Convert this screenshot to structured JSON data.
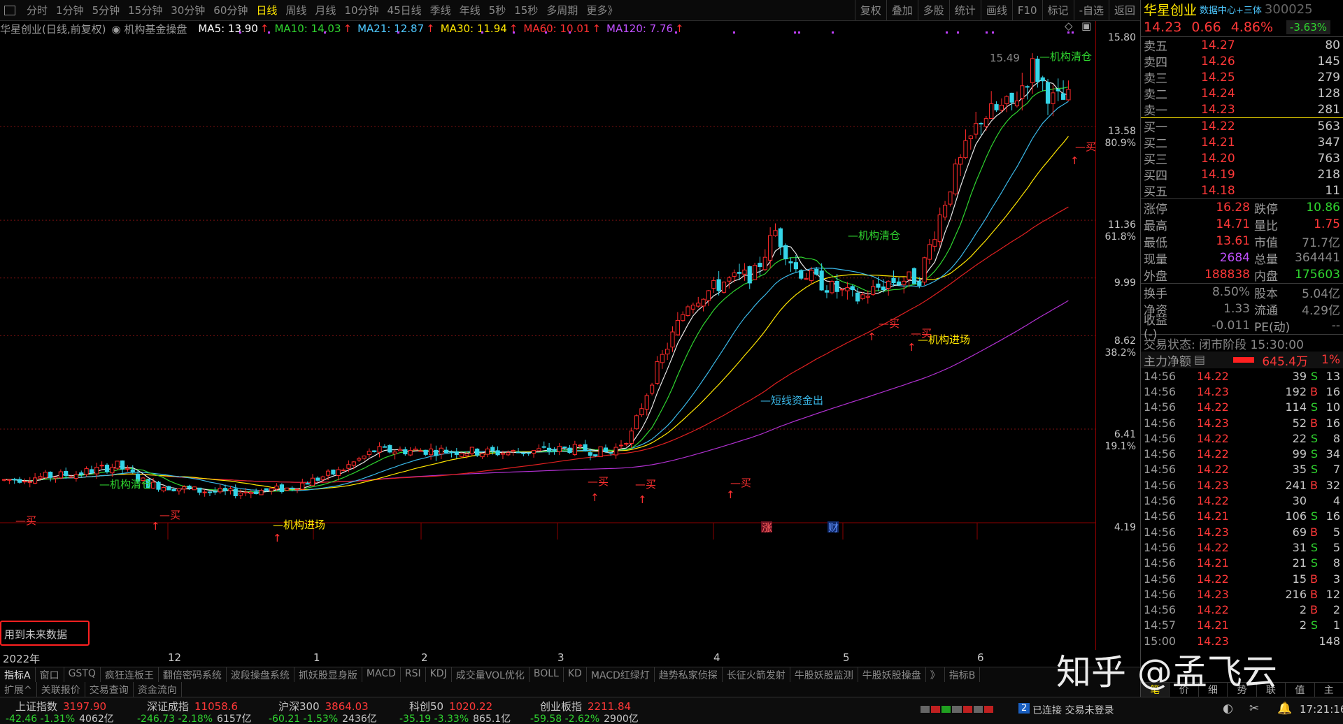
{
  "toolbar": {
    "periods": [
      "分时",
      "1分钟",
      "5分钟",
      "15分钟",
      "30分钟",
      "60分钟",
      "日线",
      "周线",
      "月线",
      "10分钟",
      "45日线",
      "季线",
      "年线",
      "5秒",
      "15秒",
      "多周期",
      "更多》"
    ],
    "active_period": "日线",
    "tools": [
      "复权",
      "叠加",
      "多股",
      "统计",
      "画线",
      "F10",
      "标记",
      "-自选",
      "返回"
    ]
  },
  "info": {
    "stock_title": "华星创业(日线,前复权)",
    "indicator_name": "机构基金操盘",
    "ma": [
      {
        "label": "MA5: 13.90",
        "color": "#ffffff"
      },
      {
        "label": "MA10: 14.03",
        "color": "#2fd42f"
      },
      {
        "label": "MA21: 12.87",
        "color": "#4ec8ff"
      },
      {
        "label": "MA30: 11.94",
        "color": "#ffe600"
      },
      {
        "label": "MA60: 10.01",
        "color": "#ff3030"
      },
      {
        "label": "MA120: 7.76",
        "color": "#c050ff"
      }
    ],
    "up_arrow": "↑"
  },
  "price_axis": [
    {
      "label": "15.80"
    },
    {
      "label": "13.58",
      "pct": "80.9%"
    },
    {
      "label": "11.36",
      "pct": "61.8%"
    },
    {
      "label": "9.99"
    },
    {
      "label": "8.62",
      "pct": "38.2%"
    },
    {
      "label": "6.41",
      "pct": "19.1%"
    },
    {
      "label": "4.19"
    }
  ],
  "date_axis": [
    "2022年",
    "12",
    "1",
    "2",
    "3",
    "4",
    "5",
    "6"
  ],
  "annotations": {
    "clear_pos": "机构清仓",
    "enter": "机构进场",
    "buy": "买",
    "short_out": "短线资金出",
    "high_price": "15.49",
    "zhang": "涨",
    "cai": "财",
    "future_data": "用到未来数据"
  },
  "indicator_tabs": [
    "指标A",
    "窗口",
    "GSTQ",
    "疯狂连板王",
    "翻倍密码系统",
    "波段操盘系统",
    "抓妖股显身版",
    "MACD",
    "RSI",
    "KDJ",
    "成交量VOL优化",
    "BOLL",
    "KD",
    "MACD红绿灯",
    "趋势私家侦探",
    "长征火箭发射",
    "牛股妖股监测",
    "牛股妖股操盘",
    "》",
    "指标B"
  ],
  "ext_tabs": [
    "扩展^",
    "关联报价",
    "交易查询",
    "资金流向"
  ],
  "status": {
    "indices": [
      {
        "name": "上证指数",
        "value": "3197.90",
        "chg": "-42.46",
        "pct": "-1.31%",
        "vol": "4062亿"
      },
      {
        "name": "深证成指",
        "value": "11058.6",
        "chg": "-246.73",
        "pct": "-2.18%",
        "vol": "6157亿"
      },
      {
        "name": "沪深300",
        "value": "3864.03",
        "chg": "-60.21",
        "pct": "-1.53%",
        "vol": "2436亿"
      },
      {
        "name": "科创50",
        "value": "1020.22",
        "chg": "-35.19",
        "pct": "-3.33%",
        "vol": "865.1亿"
      },
      {
        "name": "创业板指",
        "value": "2211.84",
        "chg": "-59.58",
        "pct": "-2.62%",
        "vol": "2900亿"
      }
    ],
    "conn_num": "2",
    "connected": "已连接 交易未登录",
    "time": "17:21:16"
  },
  "right_panel": {
    "name": "华星创业",
    "tag": "数据中心+三体",
    "code": "300025",
    "price": "14.23",
    "change": "0.66",
    "change_pct": "4.86%",
    "badge": "-3.63%",
    "asks": [
      {
        "label": "卖五",
        "price": "14.27",
        "vol": "80"
      },
      {
        "label": "卖四",
        "price": "14.26",
        "vol": "145"
      },
      {
        "label": "卖三",
        "price": "14.25",
        "vol": "279"
      },
      {
        "label": "卖二",
        "price": "14.24",
        "vol": "128"
      },
      {
        "label": "卖一",
        "price": "14.23",
        "vol": "281"
      }
    ],
    "bids": [
      {
        "label": "买一",
        "price": "14.22",
        "vol": "563"
      },
      {
        "label": "买二",
        "price": "14.21",
        "vol": "347"
      },
      {
        "label": "买三",
        "price": "14.20",
        "vol": "763"
      },
      {
        "label": "买四",
        "price": "14.19",
        "vol": "218"
      },
      {
        "label": "买五",
        "price": "14.18",
        "vol": "11"
      }
    ],
    "stats1": [
      {
        "l1": "涨停",
        "v1": "16.28",
        "c1": "red",
        "l2": "跌停",
        "v2": "10.86",
        "c2": "green"
      },
      {
        "l1": "最高",
        "v1": "14.71",
        "c1": "red",
        "l2": "量比",
        "v2": "1.75",
        "c2": "red"
      },
      {
        "l1": "最低",
        "v1": "13.61",
        "c1": "red",
        "l2": "市值",
        "v2": "71.7亿",
        "c2": "gray"
      },
      {
        "l1": "现量",
        "v1": "2684",
        "c1": "purple",
        "l2": "总量",
        "v2": "364441",
        "c2": "gray"
      },
      {
        "l1": "外盘",
        "v1": "188838",
        "c1": "red",
        "l2": "内盘",
        "v2": "175603",
        "c2": "green"
      }
    ],
    "stats2": [
      {
        "l1": "换手",
        "v1": "8.50%",
        "c1": "gray",
        "l2": "股本",
        "v2": "5.04亿",
        "c2": "gray"
      },
      {
        "l1": "净资",
        "v1": "1.33",
        "c1": "gray",
        "l2": "流通",
        "v2": "4.29亿",
        "c2": "gray"
      },
      {
        "l1": "收益(-)",
        "v1": "-0.011",
        "c1": "gray",
        "l2": "PE(动)",
        "v2": "--",
        "c2": "gray"
      }
    ],
    "state": "交易状态: 闭市阶段 15:30:00",
    "flow_label": "主力净额",
    "flow_value": "645.4万",
    "flow_pct": "1%",
    "ticks": [
      {
        "t": "14:56",
        "p": "14.22",
        "q": "39",
        "s": "S",
        "n": "13"
      },
      {
        "t": "14:56",
        "p": "14.23",
        "q": "192",
        "s": "B",
        "n": "16"
      },
      {
        "t": "14:56",
        "p": "14.22",
        "q": "114",
        "s": "S",
        "n": "10"
      },
      {
        "t": "14:56",
        "p": "14.23",
        "q": "52",
        "s": "B",
        "n": "16"
      },
      {
        "t": "14:56",
        "p": "14.22",
        "q": "22",
        "s": "S",
        "n": "8"
      },
      {
        "t": "14:56",
        "p": "14.22",
        "q": "99",
        "s": "S",
        "n": "34"
      },
      {
        "t": "14:56",
        "p": "14.22",
        "q": "35",
        "s": "S",
        "n": "7"
      },
      {
        "t": "14:56",
        "p": "14.23",
        "q": "241",
        "s": "B",
        "n": "32"
      },
      {
        "t": "14:56",
        "p": "14.22",
        "q": "30",
        "s": "",
        "n": "4"
      },
      {
        "t": "14:56",
        "p": "14.21",
        "q": "106",
        "s": "S",
        "n": "16"
      },
      {
        "t": "14:56",
        "p": "14.23",
        "q": "69",
        "s": "B",
        "n": "5"
      },
      {
        "t": "14:56",
        "p": "14.22",
        "q": "31",
        "s": "S",
        "n": "5"
      },
      {
        "t": "14:56",
        "p": "14.21",
        "q": "21",
        "s": "S",
        "n": "8"
      },
      {
        "t": "14:56",
        "p": "14.22",
        "q": "15",
        "s": "B",
        "n": "3"
      },
      {
        "t": "14:56",
        "p": "14.23",
        "q": "216",
        "s": "B",
        "n": "12"
      },
      {
        "t": "14:56",
        "p": "14.22",
        "q": "2",
        "s": "B",
        "n": "2"
      },
      {
        "t": "14:57",
        "p": "14.21",
        "q": "2",
        "s": "S",
        "n": "1"
      },
      {
        "t": "15:00",
        "p": "14.23",
        "q": "",
        "s": "",
        "n": "148"
      }
    ],
    "bottom_tabs": [
      "笔",
      "价",
      "细",
      "势",
      "联",
      "值",
      "主"
    ]
  },
  "watermark": "知乎 @孟飞云"
}
